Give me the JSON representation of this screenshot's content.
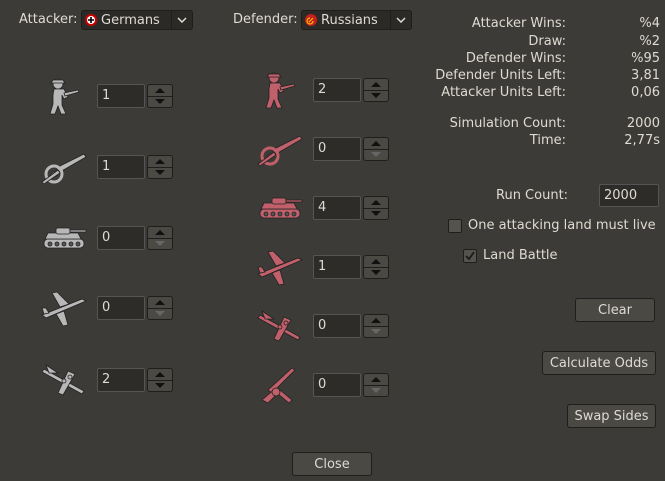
{
  "attacker": {
    "label": "Attacker:",
    "nation": "Germans"
  },
  "defender": {
    "label": "Defender:",
    "nation": "Russians"
  },
  "attacker_units": [
    {
      "icon": "infantry-icon",
      "count": "1"
    },
    {
      "icon": "artillery-icon",
      "count": "1"
    },
    {
      "icon": "tank-icon",
      "count": "0"
    },
    {
      "icon": "fighter-icon",
      "count": "0"
    },
    {
      "icon": "bomber-icon",
      "count": "2"
    }
  ],
  "defender_units": [
    {
      "icon": "infantry-icon",
      "count": "2"
    },
    {
      "icon": "artillery-icon",
      "count": "0"
    },
    {
      "icon": "tank-icon",
      "count": "4"
    },
    {
      "icon": "fighter-icon",
      "count": "1"
    },
    {
      "icon": "bomber-icon",
      "count": "0"
    },
    {
      "icon": "aa-gun-icon",
      "count": "0"
    }
  ],
  "stats": [
    {
      "label": "Attacker Wins:",
      "value": "%4"
    },
    {
      "label": "Draw:",
      "value": "%2"
    },
    {
      "label": "Defender Wins:",
      "value": "%95"
    },
    {
      "label": "Defender Units Left:",
      "value": "3,81"
    },
    {
      "label": "Attacker Units Left:",
      "value": "0,06"
    }
  ],
  "sim": [
    {
      "label": "Simulation Count:",
      "value": "2000"
    },
    {
      "label": "Time:",
      "value": "2,77s"
    }
  ],
  "run_count": {
    "label": "Run Count:",
    "value": "2000"
  },
  "options": {
    "one_attacking_land": "One attacking land must live",
    "land_battle": "Land Battle"
  },
  "buttons": {
    "clear": "Clear",
    "calculate": "Calculate Odds",
    "swap": "Swap Sides",
    "close": "Close"
  },
  "colors": {
    "attacker_unit": "#b8b8b8",
    "defender_unit": "#c0606a",
    "background": "#3c3b37"
  }
}
